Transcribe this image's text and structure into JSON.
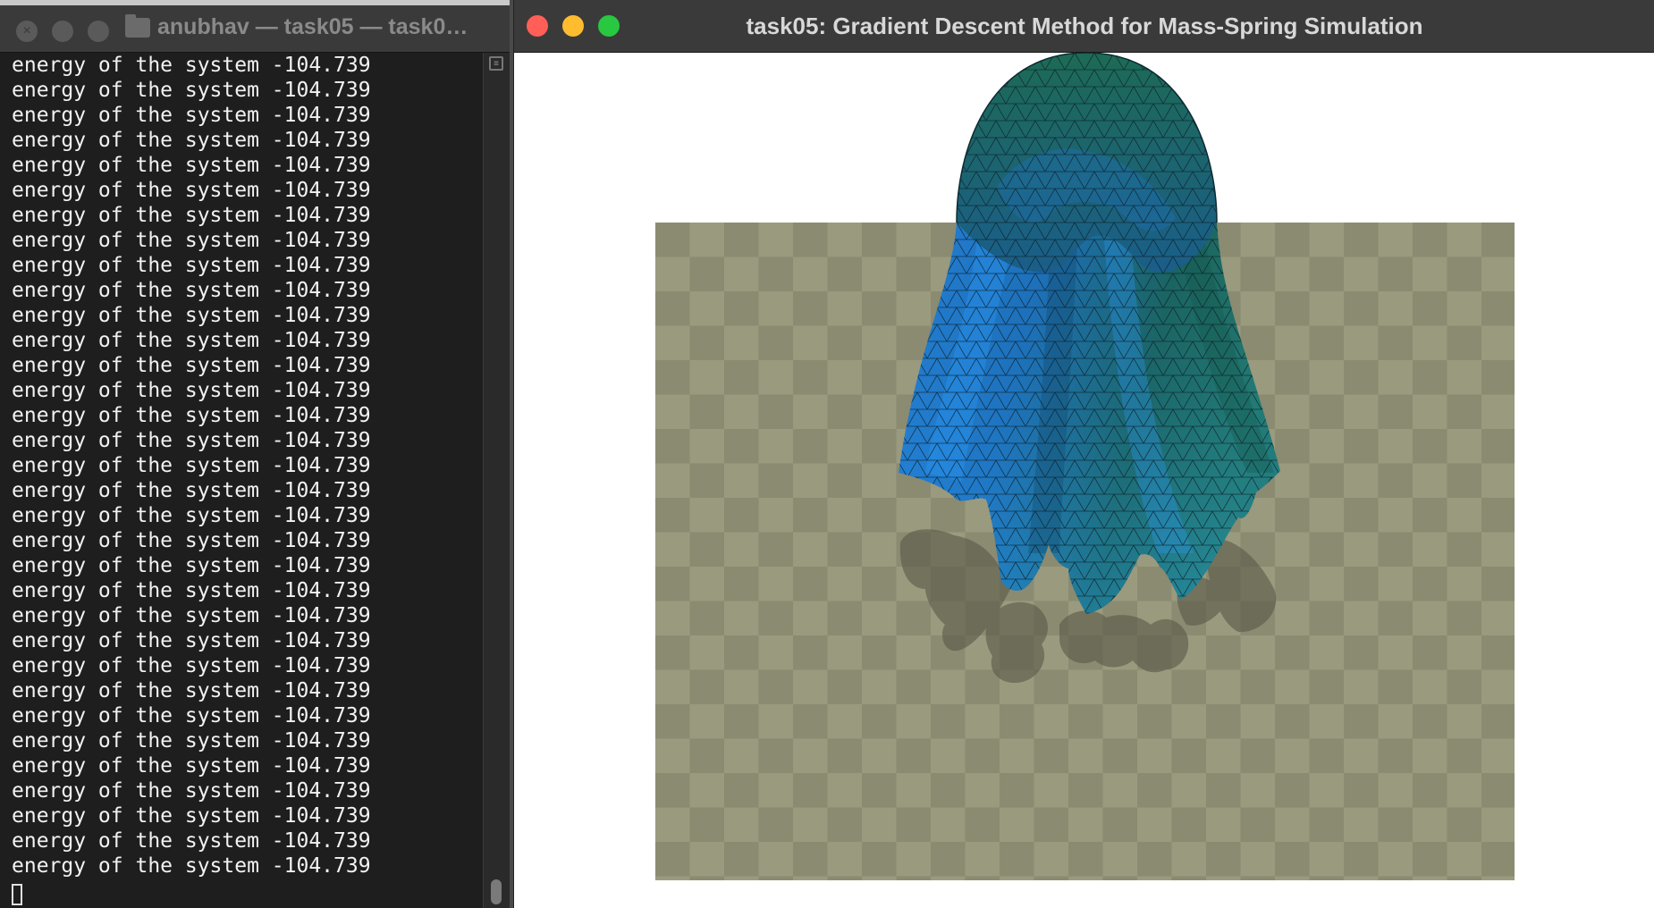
{
  "terminal": {
    "title": "anubhav — task05 — task0…",
    "prompt_cursor": "",
    "line_text": "energy of the system -104.739",
    "line_count": 33,
    "icons": [
      "close-icon",
      "minimize-icon",
      "zoom-icon",
      "folder-icon",
      "split-pane-icon"
    ]
  },
  "simulation": {
    "title": "task05: Gradient Descent Method for Mass-Spring Simulation",
    "colors": {
      "background": "#ffffff",
      "floor_light": "#9a9a7e",
      "floor_dark": "#8a8a70",
      "cloth_blue": "#2a8ff0",
      "cloth_green": "#1d6a55",
      "shadow": "#5c5c4c",
      "close": "#ff5f57",
      "minimize": "#febc2e",
      "zoom": "#28c840"
    }
  }
}
